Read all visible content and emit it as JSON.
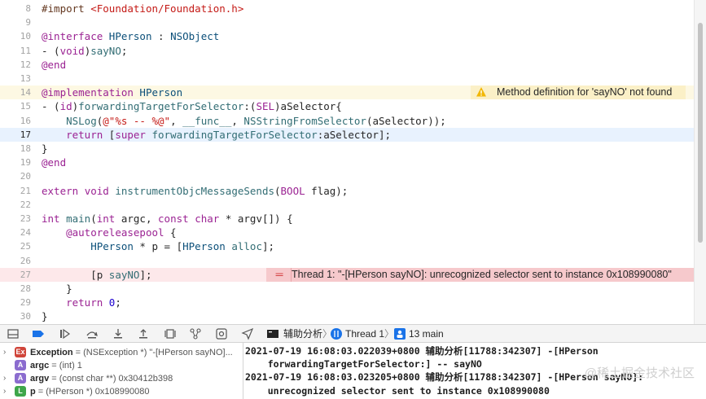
{
  "editor": {
    "lines": [
      {
        "num": "8",
        "code": "#import <Foundation/Foundation.h>"
      },
      {
        "num": "9",
        "code": ""
      },
      {
        "num": "10",
        "code": "@interface HPerson : NSObject"
      },
      {
        "num": "11",
        "code": "- (void)sayNO;"
      },
      {
        "num": "12",
        "code": "@end"
      },
      {
        "num": "13",
        "code": ""
      },
      {
        "num": "14",
        "code": "@implementation HPerson"
      },
      {
        "num": "15",
        "code": "- (id)forwardingTargetForSelector:(SEL)aSelector{"
      },
      {
        "num": "16",
        "code": "    NSLog(@\"%s -- %@\", __func__, NSStringFromSelector(aSelector));"
      },
      {
        "num": "17",
        "code": "    return [super forwardingTargetForSelector:aSelector];"
      },
      {
        "num": "18",
        "code": "}"
      },
      {
        "num": "19",
        "code": "@end"
      },
      {
        "num": "20",
        "code": ""
      },
      {
        "num": "21",
        "code": "extern void instrumentObjcMessageSends(BOOL flag);"
      },
      {
        "num": "22",
        "code": ""
      },
      {
        "num": "23",
        "code": "int main(int argc, const char * argv[]) {"
      },
      {
        "num": "24",
        "code": "    @autoreleasepool {"
      },
      {
        "num": "25",
        "code": "        HPerson * p = [HPerson alloc];"
      },
      {
        "num": "26",
        "code": ""
      },
      {
        "num": "27",
        "code": "        [p sayNO];"
      },
      {
        "num": "28",
        "code": "    }"
      },
      {
        "num": "29",
        "code": "    return 0;"
      },
      {
        "num": "30",
        "code": "}"
      }
    ],
    "warning": "Method definition for 'sayNO' not found",
    "error": "Thread 1: \"-[HPerson sayNO]: unrecognized selector sent to instance 0x108990080\""
  },
  "toolbar": {
    "crumbs": [
      "辅助分析",
      "Thread 1",
      "13 main"
    ]
  },
  "variables": [
    {
      "badge": "Ex",
      "badge_color": "#d0453a",
      "name": "Exception",
      "rest": " = (NSException *) \"-[HPerson sayNO]...",
      "disclosure": "›"
    },
    {
      "badge": "A",
      "badge_color": "#8b6ccf",
      "name": "argc",
      "rest": " = (int) 1",
      "disclosure": ""
    },
    {
      "badge": "A",
      "badge_color": "#8b6ccf",
      "name": "argv",
      "rest": " = (const char **) 0x30412b398",
      "disclosure": "›"
    },
    {
      "badge": "L",
      "badge_color": "#3ea64a",
      "name": "p",
      "rest": " = (HPerson *) 0x108990080",
      "disclosure": "›"
    }
  ],
  "console": {
    "lines": [
      "2021-07-19 16:08:03.022039+0800 辅助分析[11788:342307] -[HPerson",
      "    forwardingTargetForSelector:] -- sayNO",
      "2021-07-19 16:08:03.023205+0800 辅助分析[11788:342307] -[HPerson sayNO]:",
      "    unrecognized selector sent to instance 0x108990080"
    ],
    "watermark": "@稀土掘金技术社区"
  }
}
